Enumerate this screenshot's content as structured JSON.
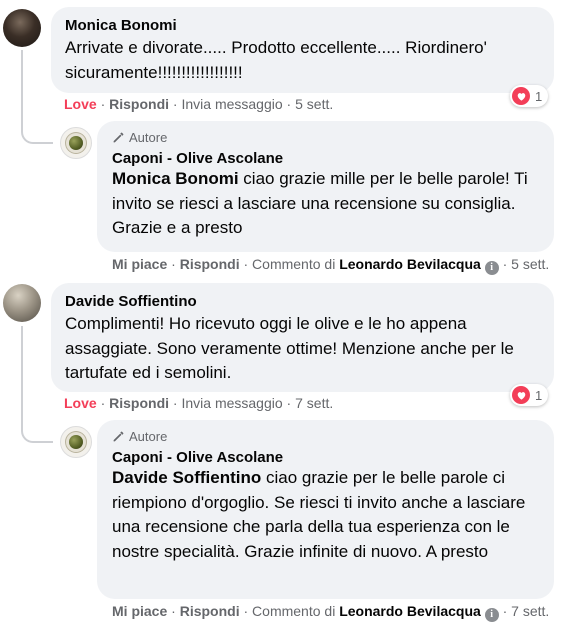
{
  "threads": [
    {
      "comment": {
        "author": "Monica Bonomi",
        "text": "Arrivate e divorate..... Prodotto eccellente..... Riordinero' sicuramente!!!!!!!!!!!!!!!!!!",
        "reaction_label": "Love",
        "reply_label": "Rispondi",
        "message_label": "Invia messaggio",
        "time": "5 sett.",
        "reaction_count": "1"
      },
      "reply": {
        "badge": "Autore",
        "author": "Caponi - Olive Ascolane",
        "mention": "Monica Bonomi",
        "text": " ciao grazie mille per le belle parole! Ti invito se riesci a lasciare una recensione su consiglia. Grazie e a presto",
        "like_label": "Mi piace",
        "reply_label": "Rispondi",
        "comment_by_prefix": "Commento di",
        "comment_by": "Leonardo Bevilacqua",
        "time": "5 sett."
      }
    },
    {
      "comment": {
        "author": "Davide Soffientino",
        "text": "Complimenti! Ho ricevuto oggi le olive e le ho appena assaggiate. Sono veramente ottime! Menzione anche per le tartufate ed i semolini.",
        "reaction_label": "Love",
        "reply_label": "Rispondi",
        "message_label": "Invia messaggio",
        "time": "7 sett.",
        "reaction_count": "1"
      },
      "reply": {
        "badge": "Autore",
        "author": "Caponi - Olive Ascolane",
        "mention": "Davide Soffientino",
        "text": " ciao grazie per le belle parole ci riempiono d'orgoglio. Se riesci ti invito anche a lasciare una recensione che parla della tua esperienza con le nostre specialità. Grazie infinite di nuovo. A presto",
        "like_label": "Mi piace",
        "reply_label": "Rispondi",
        "comment_by_prefix": "Commento di",
        "comment_by": "Leonardo Bevilacqua",
        "time": "7 sett."
      }
    }
  ],
  "separator": "·",
  "info_glyph": "i",
  "colors": {
    "love": "#f33e58",
    "bubble": "#f0f2f5",
    "meta": "#65676b"
  }
}
